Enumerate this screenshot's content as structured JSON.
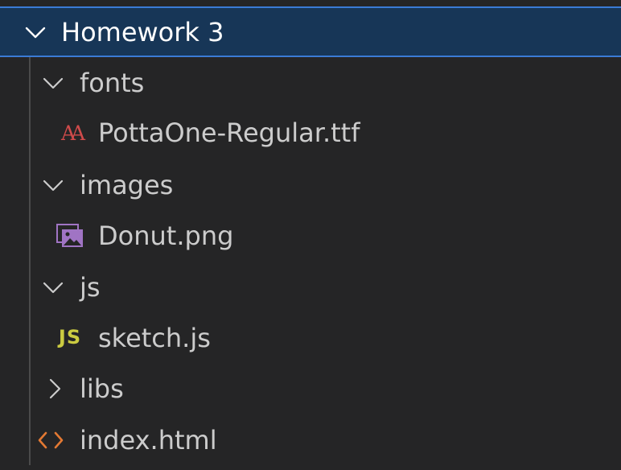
{
  "explorer": {
    "root": {
      "label": "Homework 3",
      "expanded": true
    },
    "items": [
      {
        "label": "fonts",
        "type": "folder",
        "expanded": true
      },
      {
        "label": "PottaOne-Regular.ttf",
        "type": "file",
        "icon": "font-file-icon"
      },
      {
        "label": "images",
        "type": "folder",
        "expanded": true
      },
      {
        "label": "Donut.png",
        "type": "file",
        "icon": "image-file-icon"
      },
      {
        "label": "js",
        "type": "folder",
        "expanded": true
      },
      {
        "label": "sketch.js",
        "type": "file",
        "icon": "javascript-file-icon",
        "icon_text": "JS"
      },
      {
        "label": "libs",
        "type": "folder",
        "expanded": false
      },
      {
        "label": "index.html",
        "type": "file",
        "icon": "html-file-icon"
      }
    ]
  },
  "colors": {
    "background": "#252526",
    "selected_row": "#173657",
    "selected_border": "#3a7bd5",
    "font_icon": "#d14b4b",
    "image_icon": "#a074c4",
    "js_icon": "#cbcb41",
    "html_icon": "#e37933"
  }
}
